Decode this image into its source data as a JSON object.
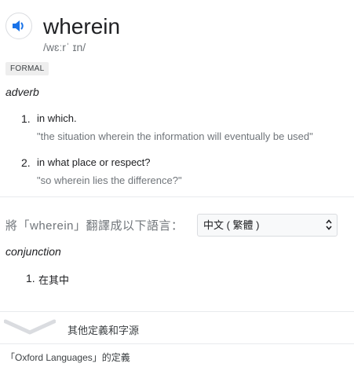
{
  "entry": {
    "word": "wherein",
    "phonetic": "/wɛːrˈ ɪn/",
    "register": "FORMAL",
    "part_of_speech": "adverb",
    "senses": [
      {
        "number": "1.",
        "definition": "in which.",
        "example": "\"the situation wherein the information will eventually be used\""
      },
      {
        "number": "2.",
        "definition": "in what place or respect?",
        "example": "\"so wherein lies the difference?\""
      }
    ]
  },
  "translation": {
    "label": "將「wherein」翻譯成以下語言：",
    "language_selected": "中文 ( 繁體 )",
    "part_of_speech": "conjunction",
    "senses": [
      {
        "number": "1.",
        "text": "在其中"
      }
    ]
  },
  "footer": {
    "more_link": "其他定義和字源",
    "source": "「Oxford Languages」的定義"
  },
  "colors": {
    "accent": "#1a73e8",
    "muted": "#70757a",
    "text": "#202124"
  },
  "icons": {
    "audio": "speaker-icon",
    "expand": "chevron-down-icon",
    "select": "select-arrows-icon"
  }
}
